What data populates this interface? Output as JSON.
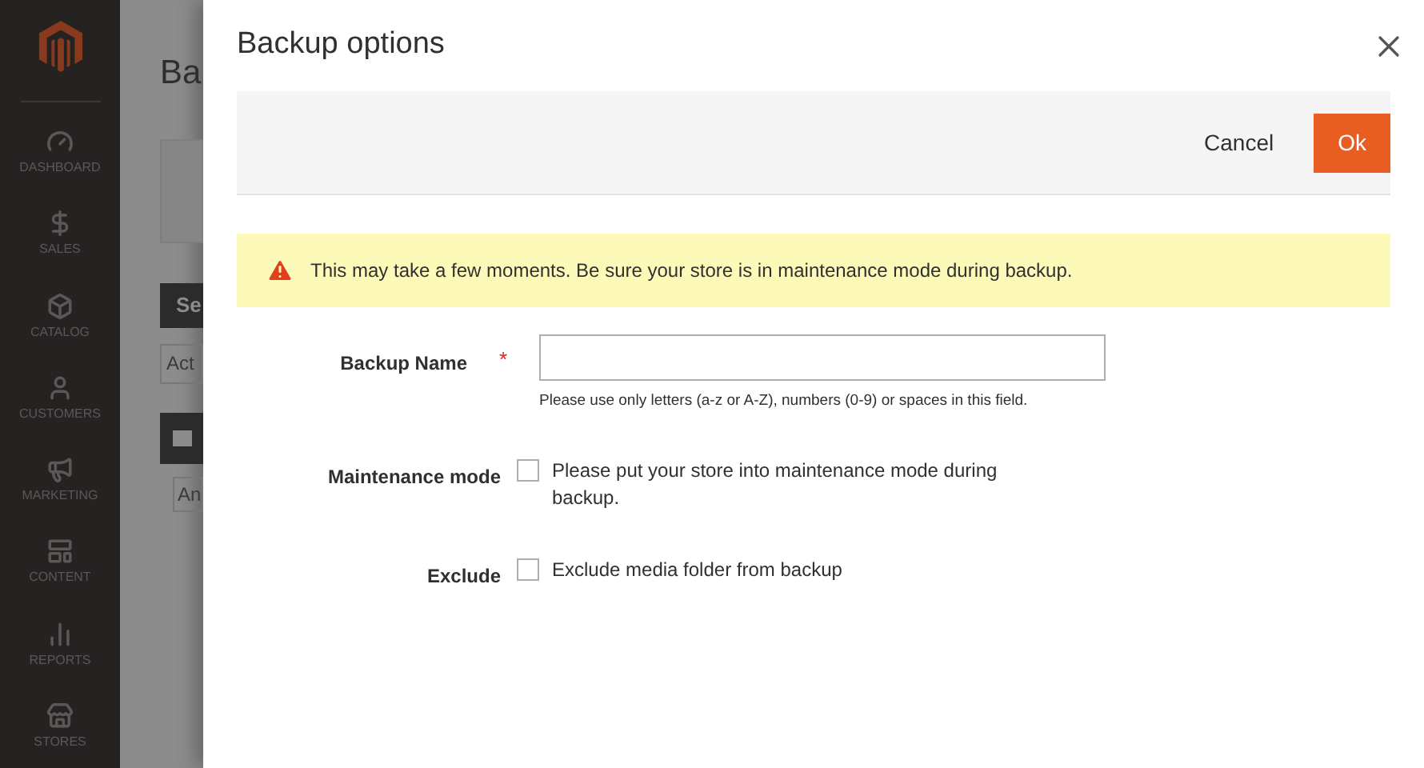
{
  "sidebar": {
    "items": [
      {
        "kind": "dashboard",
        "label": "DASHBOARD"
      },
      {
        "kind": "sales",
        "label": "SALES"
      },
      {
        "kind": "catalog",
        "label": "CATALOG"
      },
      {
        "kind": "customers",
        "label": "CUSTOMERS"
      },
      {
        "kind": "marketing",
        "label": "MARKETING"
      },
      {
        "kind": "content",
        "label": "CONTENT"
      },
      {
        "kind": "reports",
        "label": "REPORTS"
      },
      {
        "kind": "stores",
        "label": "STORES"
      }
    ]
  },
  "page": {
    "title": "Ba",
    "button": "Se",
    "select": "Act",
    "filter": "An"
  },
  "modal": {
    "title": "Backup options",
    "buttons": {
      "cancel": "Cancel",
      "ok": "Ok"
    },
    "warning": "This may take a few moments. Be sure your store is in maintenance mode during backup.",
    "backup_name": {
      "label": "Backup Name",
      "required_mark": "*",
      "note": "Please use only letters (a-z or A-Z), numbers (0-9) or spaces in this field."
    },
    "options": [
      {
        "label": "Maintenance mode",
        "text": "Please put your store into maintenance mode during backup.",
        "checked": false
      },
      {
        "label": "Exclude",
        "text": "Exclude media folder from backup",
        "checked": false
      }
    ]
  }
}
